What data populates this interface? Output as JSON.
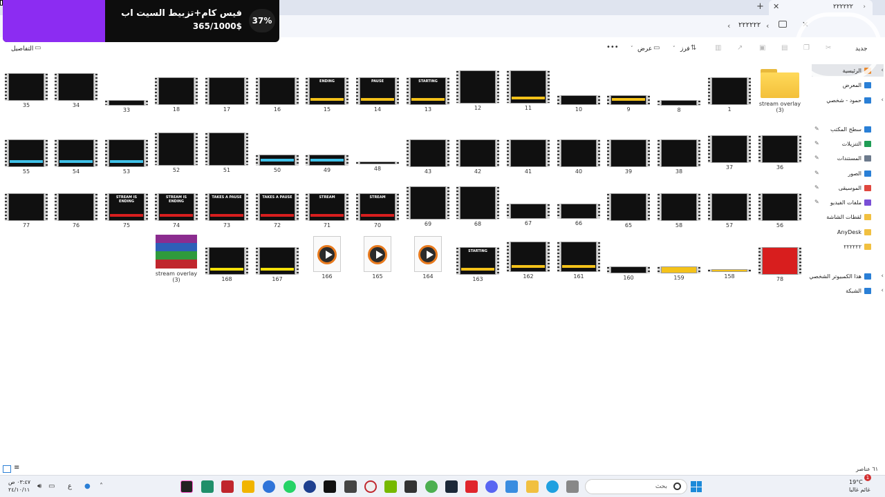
{
  "overlay": {
    "title": "فيس كام+تزبيط السيت اب",
    "amount": "365/1000$",
    "percent_label": "37%",
    "progress": 0.37,
    "fill_color": "#8c2cf2"
  },
  "titlebar": {
    "tab_label": "۲۲۲۲۲۲",
    "close_icon": "close-icon",
    "new_tab_icon": "plus-icon"
  },
  "address": {
    "current_folder": "۲۲۲۲۲۲"
  },
  "toolbar": {
    "details_label": "التفاصيل",
    "view_label": "عرض",
    "sort_label": "فرز",
    "new_label": "جديد",
    "more_label": "•••"
  },
  "files": [
    {
      "name": "stream overlay (3)",
      "kind": "folder"
    },
    {
      "name": "1",
      "kind": "video"
    },
    {
      "name": "8",
      "kind": "video"
    },
    {
      "name": "9",
      "kind": "video"
    },
    {
      "name": "10",
      "kind": "video"
    },
    {
      "name": "11",
      "kind": "video"
    },
    {
      "name": "12",
      "kind": "video"
    },
    {
      "name": "13",
      "kind": "video",
      "text": "STARTING"
    },
    {
      "name": "14",
      "kind": "video",
      "text": "PAUSE"
    },
    {
      "name": "15",
      "kind": "video",
      "text": "ENDING"
    },
    {
      "name": "16",
      "kind": "video"
    },
    {
      "name": "17",
      "kind": "video"
    },
    {
      "name": "18",
      "kind": "video"
    },
    {
      "name": "33",
      "kind": "video"
    },
    {
      "name": "34",
      "kind": "video"
    },
    {
      "name": "35",
      "kind": "video"
    },
    {
      "name": "36",
      "kind": "video"
    },
    {
      "name": "37",
      "kind": "video"
    },
    {
      "name": "38",
      "kind": "video"
    },
    {
      "name": "39",
      "kind": "video"
    },
    {
      "name": "40",
      "kind": "video"
    },
    {
      "name": "41",
      "kind": "video"
    },
    {
      "name": "42",
      "kind": "video"
    },
    {
      "name": "43",
      "kind": "video"
    },
    {
      "name": "48",
      "kind": "video"
    },
    {
      "name": "49",
      "kind": "video"
    },
    {
      "name": "50",
      "kind": "video"
    },
    {
      "name": "51",
      "kind": "video"
    },
    {
      "name": "52",
      "kind": "video"
    },
    {
      "name": "53",
      "kind": "video"
    },
    {
      "name": "54",
      "kind": "video"
    },
    {
      "name": "55",
      "kind": "video"
    },
    {
      "name": "56",
      "kind": "video"
    },
    {
      "name": "57",
      "kind": "video"
    },
    {
      "name": "58",
      "kind": "video"
    },
    {
      "name": "65",
      "kind": "video"
    },
    {
      "name": "66",
      "kind": "video"
    },
    {
      "name": "67",
      "kind": "video"
    },
    {
      "name": "68",
      "kind": "video"
    },
    {
      "name": "69",
      "kind": "video"
    },
    {
      "name": "70",
      "kind": "video",
      "text": "STREAM"
    },
    {
      "name": "71",
      "kind": "video",
      "text": "STREAM"
    },
    {
      "name": "72",
      "kind": "video",
      "text": "TAKES A PAUSE"
    },
    {
      "name": "73",
      "kind": "video",
      "text": "TAKES A PAUSE"
    },
    {
      "name": "74",
      "kind": "video",
      "text": "STREAM IS ENDING"
    },
    {
      "name": "75",
      "kind": "video",
      "text": "STREAM IS ENDING"
    },
    {
      "name": "76",
      "kind": "video"
    },
    {
      "name": "77",
      "kind": "video"
    },
    {
      "name": "78",
      "kind": "video"
    },
    {
      "name": "158",
      "kind": "video"
    },
    {
      "name": "159",
      "kind": "video"
    },
    {
      "name": "160",
      "kind": "video"
    },
    {
      "name": "161",
      "kind": "video"
    },
    {
      "name": "162",
      "kind": "video"
    },
    {
      "name": "163",
      "kind": "video",
      "text": "STARTING"
    },
    {
      "name": "164",
      "kind": "media"
    },
    {
      "name": "165",
      "kind": "media"
    },
    {
      "name": "166",
      "kind": "media"
    },
    {
      "name": "167",
      "kind": "video"
    },
    {
      "name": "168",
      "kind": "video"
    },
    {
      "name": "stream overlay (3)",
      "kind": "archive"
    }
  ],
  "nav": {
    "items": [
      {
        "label": "الرئيسية",
        "icon": "home-icon",
        "color": "#e9892d"
      },
      {
        "label": "المعرض",
        "icon": "gallery-icon",
        "color": "#2a7fd6"
      },
      {
        "label": "حمود - شخصي",
        "icon": "cloud-icon",
        "color": "#2a7fd6"
      },
      {
        "label": "سطح المكتب",
        "icon": "desktop-icon",
        "color": "#2a7fd6"
      },
      {
        "label": "التنزيلات",
        "icon": "download-icon",
        "color": "#1f9d55"
      },
      {
        "label": "المستندات",
        "icon": "documents-icon",
        "color": "#6c7a8c"
      },
      {
        "label": "الصور",
        "icon": "pictures-icon",
        "color": "#2a7fd6"
      },
      {
        "label": "الموسيقى",
        "icon": "music-icon",
        "color": "#e0473e"
      },
      {
        "label": "ملفات الفيديو",
        "icon": "videos-icon",
        "color": "#7a4fd6"
      },
      {
        "label": "لقطات الشاشة",
        "icon": "folder-icon",
        "color": "#f1c040"
      },
      {
        "label": "AnyDesk",
        "icon": "folder-icon",
        "color": "#f1c040"
      },
      {
        "label": "۲۲۲۲۲۲",
        "icon": "folder-icon",
        "color": "#f1c040"
      },
      {
        "label": "هذا الكمبيوتر الشخصي",
        "icon": "pc-icon",
        "color": "#2a7fd6"
      },
      {
        "label": "الشبكة",
        "icon": "network-icon",
        "color": "#2a7fd6"
      }
    ]
  },
  "status": {
    "count": "٦١ عناصر"
  },
  "taskbar": {
    "search_placeholder": "بحث",
    "weather_temp": "19°C",
    "weather_desc": "غائم غالبا",
    "clock_time": "٠٣:٤٧ ص",
    "clock_date": "٢٤/١٠/١١",
    "lang": "ع",
    "notification_count": "1"
  }
}
